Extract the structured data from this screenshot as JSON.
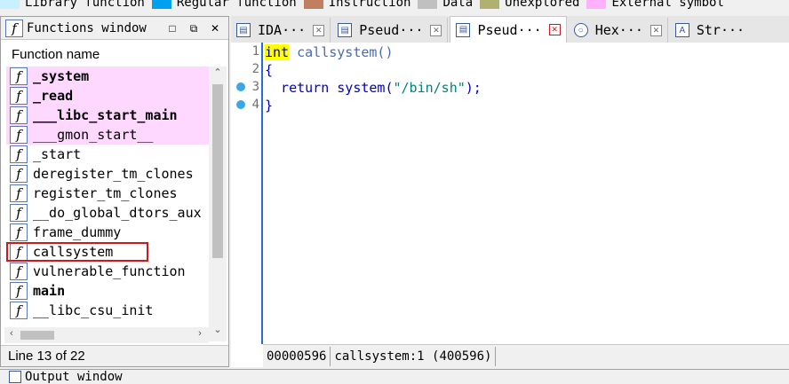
{
  "legend": [
    {
      "label": "Library function",
      "color": "#c8f0ff"
    },
    {
      "label": "Regular function",
      "color": "#00a0f0"
    },
    {
      "label": "Instruction",
      "color": "#c08060"
    },
    {
      "label": "Data",
      "color": "#c0c0c0"
    },
    {
      "label": "Unexplored",
      "color": "#b0b070"
    },
    {
      "label": "External symbol",
      "color": "#ffb0ff"
    }
  ],
  "functions_window": {
    "title": "Functions window",
    "column_header": "Function name",
    "rows": [
      {
        "name": "_system",
        "bold": true,
        "external": true
      },
      {
        "name": "_read",
        "bold": true,
        "external": true
      },
      {
        "name": "___libc_start_main",
        "bold": true,
        "external": true
      },
      {
        "name": "___gmon_start__",
        "bold": false,
        "external": true
      },
      {
        "name": "_start",
        "bold": false,
        "external": false
      },
      {
        "name": "deregister_tm_clones",
        "bold": false,
        "external": false
      },
      {
        "name": "register_tm_clones",
        "bold": false,
        "external": false
      },
      {
        "name": "__do_global_dtors_aux",
        "bold": false,
        "external": false
      },
      {
        "name": "frame_dummy",
        "bold": false,
        "external": false
      },
      {
        "name": "callsystem",
        "bold": false,
        "external": false,
        "selected": true
      },
      {
        "name": "vulnerable_function",
        "bold": false,
        "external": false
      },
      {
        "name": "main",
        "bold": true,
        "external": false
      },
      {
        "name": "__libc_csu_init",
        "bold": false,
        "external": false
      }
    ],
    "status": "Line 13 of 22"
  },
  "tabs": [
    {
      "label": "IDA···",
      "active": false
    },
    {
      "label": "Pseud···",
      "active": false
    },
    {
      "label": "Pseud···",
      "active": true
    },
    {
      "label": "Hex···",
      "active": false
    },
    {
      "label": "Str···",
      "active": false
    }
  ],
  "code": {
    "lines": [
      {
        "num": "1",
        "breakpoint": false
      },
      {
        "num": "2",
        "breakpoint": false
      },
      {
        "num": "3",
        "breakpoint": true
      },
      {
        "num": "4",
        "breakpoint": true
      }
    ],
    "line1_kw": "int",
    "line1_rest": " callsystem()",
    "line2": "{",
    "line3_pre": "  return system(",
    "line3_str": "\"/bin/sh\"",
    "line3_post": ");",
    "line4": "}",
    "status_addr": "00000596",
    "status_loc": "callsystem:1 (400596)"
  },
  "output": {
    "label": "Output window"
  }
}
